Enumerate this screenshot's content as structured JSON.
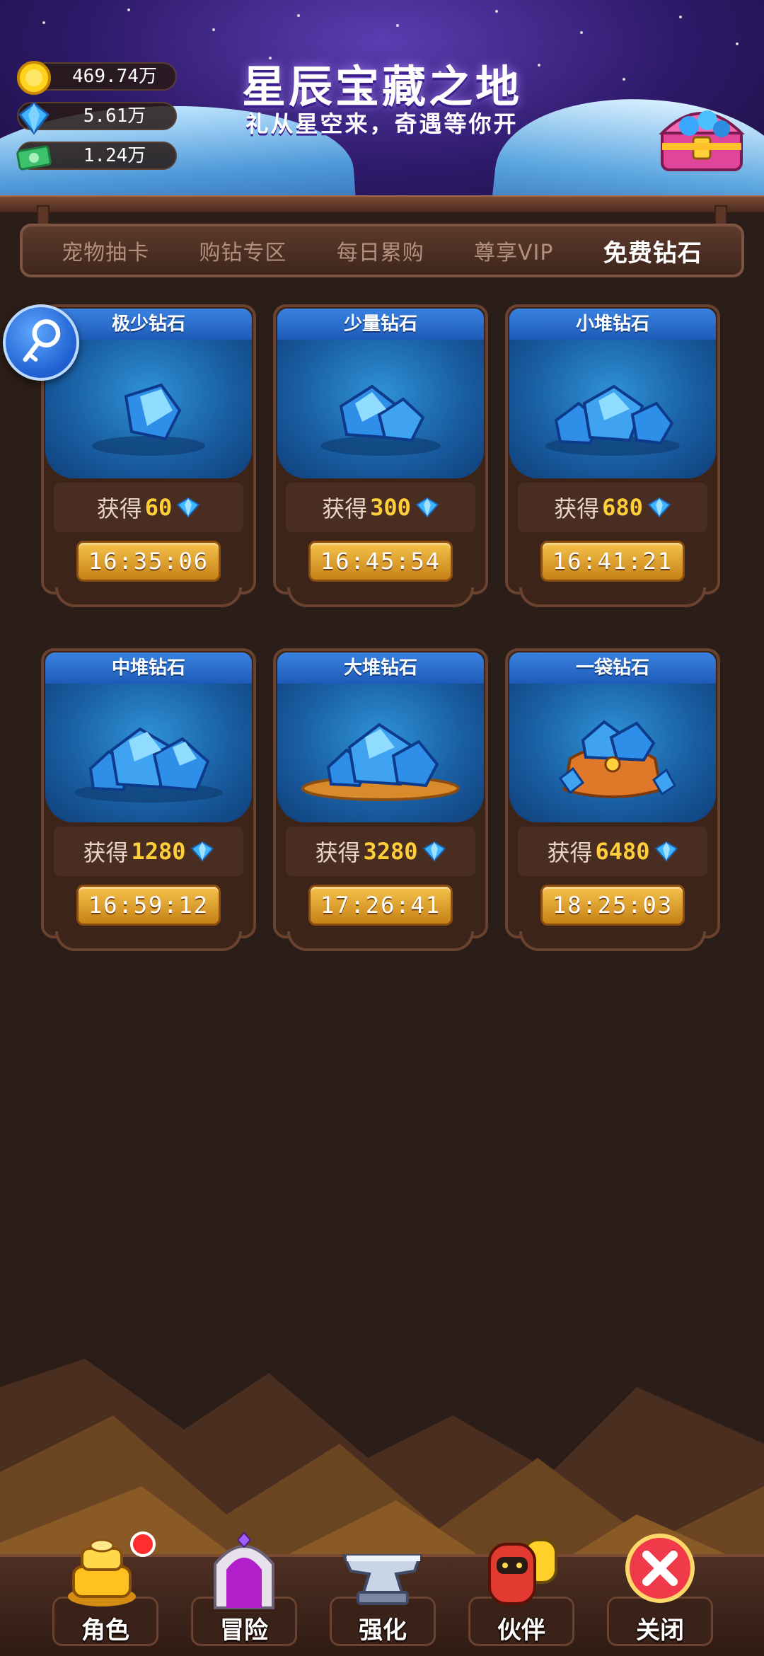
{
  "header": {
    "title": "星辰宝藏之地",
    "subtitle": "礼从星空来，奇遇等你开"
  },
  "currencies": [
    {
      "icon": "gold-coin-icon",
      "value": "469.74万"
    },
    {
      "icon": "diamond-icon",
      "value": "5.61万"
    },
    {
      "icon": "cash-icon",
      "value": "1.24万"
    }
  ],
  "tabs": [
    {
      "label": "宠物抽卡",
      "active": false
    },
    {
      "label": "购钻专区",
      "active": false
    },
    {
      "label": "每日累购",
      "active": false
    },
    {
      "label": "尊享VIP",
      "active": false
    },
    {
      "label": "免费钻石",
      "active": true
    }
  ],
  "cards": [
    {
      "title": "极少钻石",
      "reward_label": "获得",
      "amount": "60",
      "timer": "16:35:06"
    },
    {
      "title": "少量钻石",
      "reward_label": "获得",
      "amount": "300",
      "timer": "16:45:54"
    },
    {
      "title": "小堆钻石",
      "reward_label": "获得",
      "amount": "680",
      "timer": "16:41:21"
    },
    {
      "title": "中堆钻石",
      "reward_label": "获得",
      "amount": "1280",
      "timer": "16:59:12"
    },
    {
      "title": "大堆钻石",
      "reward_label": "获得",
      "amount": "3280",
      "timer": "17:26:41"
    },
    {
      "title": "一袋钻石",
      "reward_label": "获得",
      "amount": "6480",
      "timer": "18:25:03"
    }
  ],
  "nav": [
    {
      "label": "角色",
      "icon": "gold-stack-icon",
      "badge": true
    },
    {
      "label": "冒险",
      "icon": "portal-gate-icon",
      "badge": false
    },
    {
      "label": "强化",
      "icon": "anvil-icon",
      "badge": false
    },
    {
      "label": "伙伴",
      "icon": "companion-icon",
      "badge": false
    },
    {
      "label": "关闭",
      "icon": "close-icon",
      "badge": false
    }
  ],
  "colors": {
    "accent_gold": "#ffcf3a",
    "card_blue": "#1e5bb8",
    "frame_brown": "#3c2419"
  }
}
